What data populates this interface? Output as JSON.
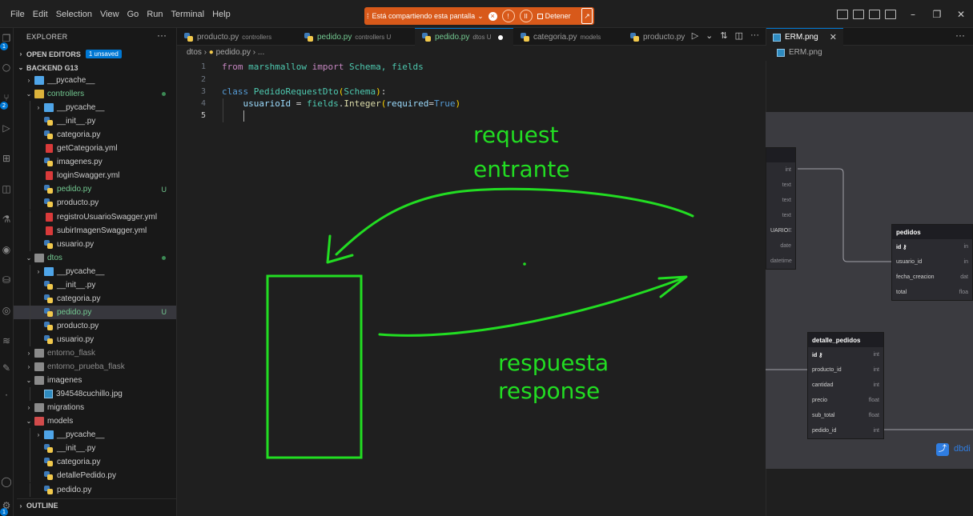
{
  "menu": [
    "File",
    "Edit",
    "Selection",
    "View",
    "Go",
    "Run",
    "Terminal",
    "Help"
  ],
  "share_bar": {
    "text": "Está compartiendo esta pantalla",
    "stop_label": "Detener"
  },
  "window_controls": {
    "minimize": "–",
    "restore": "❐",
    "close": "✕"
  },
  "activity_bar": {
    "badges": [
      "1",
      "2",
      "1"
    ]
  },
  "sidebar": {
    "title": "EXPLORER",
    "more": "···",
    "open_editors": {
      "label": "OPEN EDITORS",
      "badge": "1 unsaved"
    },
    "project": "BACKEND G13",
    "outline": "OUTLINE",
    "tree": [
      {
        "name": "__pycache__",
        "icon": "folder-blue",
        "chev": "›",
        "indent": 1,
        "color": "normal"
      },
      {
        "name": "controllers",
        "icon": "folder-yellow",
        "chev": "⌄",
        "indent": 1,
        "color": "green",
        "status": "dot"
      },
      {
        "name": "__pycache__",
        "icon": "folder-blue",
        "chev": "›",
        "indent": 2,
        "color": "normal"
      },
      {
        "name": "__init__.py",
        "icon": "py",
        "indent": 2,
        "color": "normal"
      },
      {
        "name": "categoria.py",
        "icon": "py",
        "indent": 2,
        "color": "normal"
      },
      {
        "name": "getCategoria.yml",
        "icon": "yml",
        "indent": 2,
        "color": "normal"
      },
      {
        "name": "imagenes.py",
        "icon": "py",
        "indent": 2,
        "color": "normal"
      },
      {
        "name": "loginSwagger.yml",
        "icon": "yml",
        "indent": 2,
        "color": "normal"
      },
      {
        "name": "pedido.py",
        "icon": "py",
        "indent": 2,
        "color": "green",
        "status": "U"
      },
      {
        "name": "producto.py",
        "icon": "py",
        "indent": 2,
        "color": "normal"
      },
      {
        "name": "registroUsuarioSwagger.yml",
        "icon": "yml",
        "indent": 2,
        "color": "normal"
      },
      {
        "name": "subirImagenSwagger.yml",
        "icon": "yml",
        "indent": 2,
        "color": "normal"
      },
      {
        "name": "usuario.py",
        "icon": "py",
        "indent": 2,
        "color": "normal"
      },
      {
        "name": "dtos",
        "icon": "folder",
        "chev": "⌄",
        "indent": 1,
        "color": "green",
        "status": "dot"
      },
      {
        "name": "__pycache__",
        "icon": "folder-blue",
        "chev": "›",
        "indent": 2,
        "color": "normal"
      },
      {
        "name": "__init__.py",
        "icon": "py",
        "indent": 2,
        "color": "normal"
      },
      {
        "name": "categoria.py",
        "icon": "py",
        "indent": 2,
        "color": "normal"
      },
      {
        "name": "pedido.py",
        "icon": "py",
        "indent": 2,
        "color": "green",
        "status": "U",
        "selected": true
      },
      {
        "name": "producto.py",
        "icon": "py",
        "indent": 2,
        "color": "normal"
      },
      {
        "name": "usuario.py",
        "icon": "py",
        "indent": 2,
        "color": "normal"
      },
      {
        "name": "entorno_flask",
        "icon": "folder",
        "chev": "›",
        "indent": 1,
        "color": "grey"
      },
      {
        "name": "entorno_prueba_flask",
        "icon": "folder",
        "chev": "›",
        "indent": 1,
        "color": "grey"
      },
      {
        "name": "imagenes",
        "icon": "folder",
        "chev": "⌄",
        "indent": 1,
        "color": "normal"
      },
      {
        "name": "394548cuchillo.jpg",
        "icon": "img",
        "indent": 2,
        "color": "normal"
      },
      {
        "name": "migrations",
        "icon": "folder",
        "chev": "›",
        "indent": 1,
        "color": "normal"
      },
      {
        "name": "models",
        "icon": "folder-red",
        "chev": "⌄",
        "indent": 1,
        "color": "normal"
      },
      {
        "name": "__pycache__",
        "icon": "folder-blue",
        "chev": "›",
        "indent": 2,
        "color": "normal"
      },
      {
        "name": "__init__.py",
        "icon": "py",
        "indent": 2,
        "color": "normal"
      },
      {
        "name": "categoria.py",
        "icon": "py",
        "indent": 2,
        "color": "normal"
      },
      {
        "name": "detallePedido.py",
        "icon": "py",
        "indent": 2,
        "color": "normal"
      },
      {
        "name": "pedido.py",
        "icon": "py",
        "indent": 2,
        "color": "normal"
      }
    ]
  },
  "editor": {
    "tabs": [
      {
        "name": "producto.py",
        "desc": "controllers",
        "state": "normal"
      },
      {
        "name": "pedido.py",
        "desc": "controllers U",
        "state": "green"
      },
      {
        "name": "pedido.py",
        "desc": "dtos U",
        "state": "active"
      },
      {
        "name": "categoria.py",
        "desc": "models",
        "state": "normal"
      },
      {
        "name": "producto.py",
        "desc": "",
        "state": "normal"
      }
    ],
    "tab_actions": [
      "▷",
      "⌄",
      "⇅",
      "◫",
      "···"
    ],
    "breadcrumb": [
      "dtos",
      "pedido.py",
      "..."
    ],
    "line_numbers": [
      "1",
      "2",
      "3",
      "4",
      "5"
    ],
    "code": {
      "l1": {
        "from": "from",
        "mod": "marshmallow",
        "imp": "import",
        "names": "Schema, fields"
      },
      "l3": {
        "kw": "class",
        "name": "PedidoRequestDto",
        "base": "Schema"
      },
      "l4": {
        "var": "usuarioId",
        "obj": "fields",
        "fn": "Integer",
        "arg": "required",
        "val": "True"
      }
    }
  },
  "right_pane": {
    "tab": "ERM.png",
    "close": "✕",
    "more": "···",
    "breadcrumb": "ERM.png",
    "erd": {
      "partial_table": [
        {
          "name": "",
          "type": "int"
        },
        {
          "name": "",
          "type": "text"
        },
        {
          "name": "",
          "type": "text"
        },
        {
          "name": "",
          "type": "text"
        },
        {
          "name": "UARIO",
          "type": "E"
        },
        {
          "name": "",
          "type": "date"
        },
        {
          "name": "",
          "type": "datetime"
        }
      ],
      "pedidos": {
        "title": "pedidos",
        "rows": [
          {
            "name": "id ⚷",
            "type": "in"
          },
          {
            "name": "usuario_id",
            "type": "in"
          },
          {
            "name": "fecha_creacion",
            "type": "dat"
          },
          {
            "name": "total",
            "type": "floa"
          }
        ]
      },
      "detalle_pedidos": {
        "title": "detalle_pedidos",
        "rows": [
          {
            "name": "id ⚷",
            "type": "int"
          },
          {
            "name": "producto_id",
            "type": "int"
          },
          {
            "name": "cantidad",
            "type": "int"
          },
          {
            "name": "precio",
            "type": "float"
          },
          {
            "name": "sub_total",
            "type": "float"
          },
          {
            "name": "pedido_id",
            "type": "int"
          }
        ]
      },
      "share_text": "dbdi"
    }
  },
  "annotations": {
    "request": "request",
    "entrante": "entrante",
    "respuesta": "respuesta",
    "response": "response",
    "color": "#22dd22"
  }
}
